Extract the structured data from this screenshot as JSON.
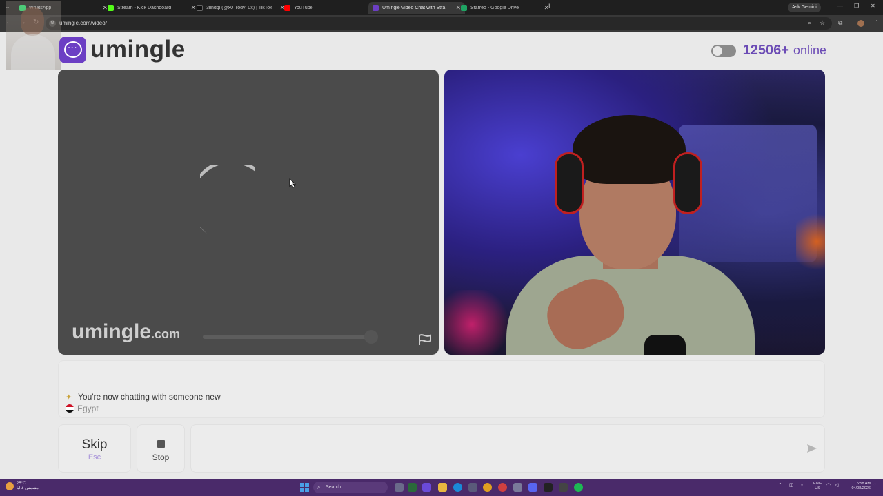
{
  "browser": {
    "tabs": [
      {
        "label": "WhatsApp",
        "color": "#25d366"
      },
      {
        "label": "Stream - Kick Dashboard",
        "color": "#53fc18"
      },
      {
        "label": "3lindgi (@x0_rody_0x) | TikTok",
        "color": "#000000"
      },
      {
        "label": "YouTube",
        "color": "#ff0000"
      },
      {
        "label": "Umingle Video Chat with Stra",
        "color": "#6c3fc4"
      },
      {
        "label": "Starred - Google Drive",
        "color": "#1fa463"
      }
    ],
    "active_tab_index": 4,
    "new_tab": "+",
    "gemini_label": "Ask Gemini",
    "url": "umingle.com/video/"
  },
  "header": {
    "logo_text": "umingle",
    "online_count": "12506+",
    "online_label": "online",
    "brand_color": "#6c3fc4"
  },
  "left_video": {
    "watermark_main": "umingle",
    "watermark_tld": ".com",
    "status": "loading"
  },
  "chat": {
    "message": "You're now chatting with someone new",
    "country": "Egypt"
  },
  "controls": {
    "skip_label": "Skip",
    "skip_hint": "Esc",
    "stop_label": "Stop",
    "message_placeholder": ""
  },
  "taskbar": {
    "weather_temp": "25°C",
    "weather_desc": "مشمس غالبا",
    "search_label": "Search",
    "lang_top": "ENG",
    "lang_bottom": "US",
    "time": "5:58 AM",
    "date": "04/08/2026"
  }
}
